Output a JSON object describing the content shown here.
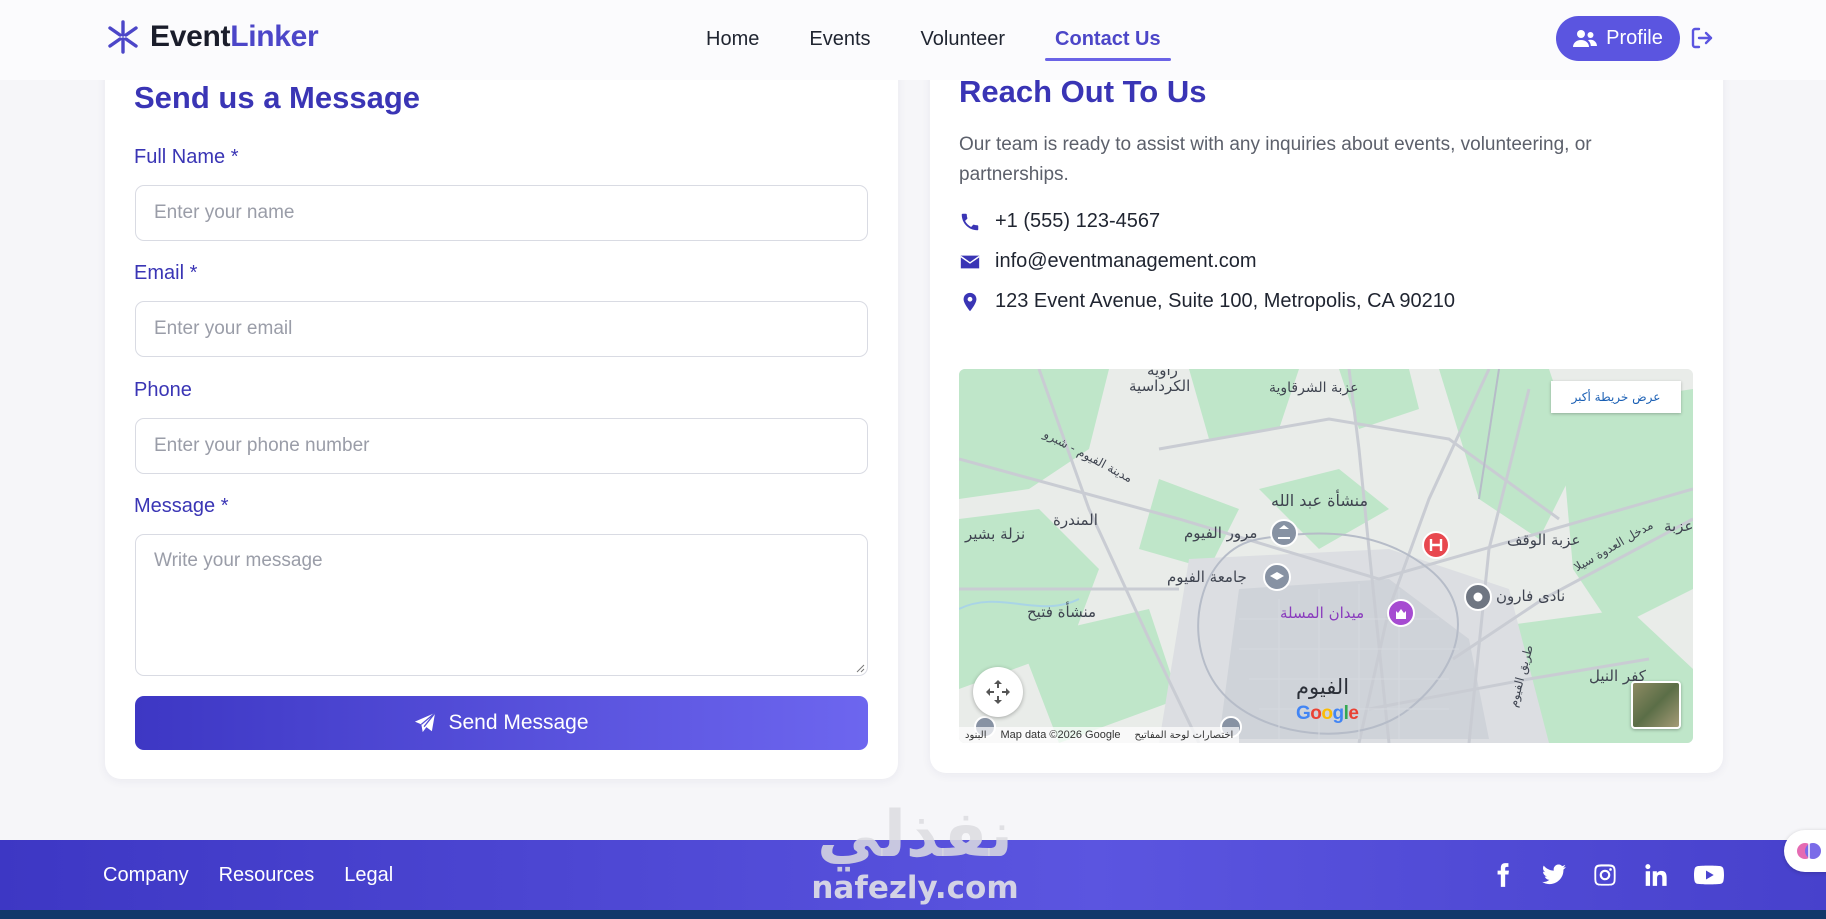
{
  "app": {
    "brand_part1": "Event",
    "brand_part2": "Linker"
  },
  "nav": {
    "items": [
      {
        "label": "Home",
        "active": false
      },
      {
        "label": "Events",
        "active": false
      },
      {
        "label": "Volunteer",
        "active": false
      },
      {
        "label": "Contact Us",
        "active": true
      }
    ],
    "profile_label": "Profile"
  },
  "form": {
    "title": "Send us a Message",
    "name_label": "Full Name *",
    "name_placeholder": "Enter your name",
    "email_label": "Email *",
    "email_placeholder": "Enter your email",
    "phone_label": "Phone",
    "phone_placeholder": "Enter your phone number",
    "message_label": "Message *",
    "message_placeholder": "Write your message",
    "submit_label": "Send Message"
  },
  "contact": {
    "title": "Reach Out To Us",
    "description": "Our team is ready to assist with any inquiries about events, volunteering, or partnerships.",
    "phone": "+1 (555) 123-4567",
    "email": "info@eventmanagement.com",
    "address": "123 Event Avenue, Suite 100, Metropolis, CA 90210"
  },
  "map": {
    "view_larger": "عرض خريطة أكبر",
    "google": "Google",
    "terms": "البنود",
    "map_data": "Map data ©2026 Google",
    "shortcuts": "اختصارات لوحة المفاتيح",
    "labels": {
      "fayoum": "الفيوم",
      "manshaat_abdallah": "منشأة عبد الله",
      "fayoum_university": "جامعة الفيوم",
      "fayoum_traffic": "مرور الفيوم",
      "masala_square": "ميدان المسلة",
      "manshaat_fateh": "منشأة فتيح",
      "izbat_alwaqf": "عزبة الوقف",
      "nadi_faroun": "نادى فارون",
      "almandara": "المندرة",
      "izbat_alsharqawiya": "عزبة الشرقاوية",
      "alkardasiya": "الكرداسية",
      "zawiya": "زاوية",
      "nazlat_bishir": "نزلة بشير",
      "kafr_alnil": "كفر النيل",
      "madinat_fayoum_road": "مدينة الفيوم - شبرو",
      "tariq_alfayoum": "طريق الفيوم",
      "madkhal_aladwa": "مدخل العدوة سيلا",
      "right_edge": "عزبة"
    }
  },
  "footer": {
    "links": [
      "Company",
      "Resources",
      "Legal"
    ],
    "socials": [
      "facebook-icon",
      "twitter-icon",
      "instagram-icon",
      "linkedin-icon",
      "youtube-icon"
    ]
  },
  "watermark": {
    "arabic": "نفذلي",
    "latin": "nafezly.com"
  },
  "colors": {
    "accent": "#4c46c8",
    "brand_purple": "#5b55e0",
    "footer_dark": "#12386a"
  }
}
